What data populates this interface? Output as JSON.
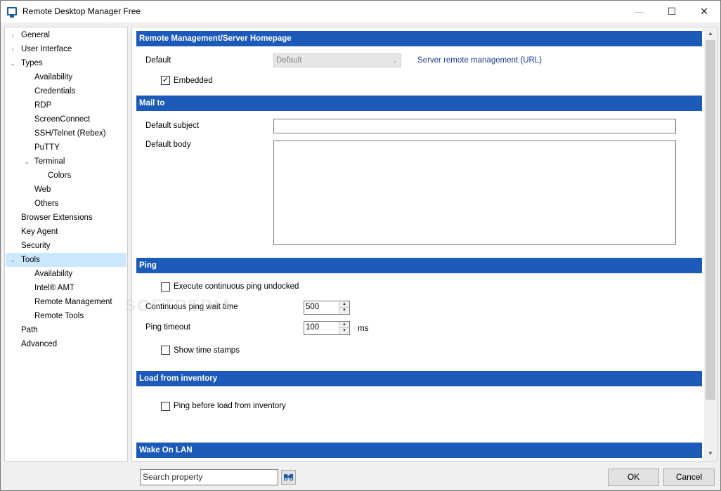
{
  "window": {
    "title": "Remote Desktop Manager Free"
  },
  "titlebar": {
    "minimize": "—",
    "maximize": "☐",
    "close": "✕"
  },
  "sidebar": {
    "items": [
      {
        "label": "General",
        "chev": "›"
      },
      {
        "label": "User Interface",
        "chev": "›"
      },
      {
        "label": "Types",
        "chev": "⌄"
      },
      {
        "label": "Availability"
      },
      {
        "label": "Credentials"
      },
      {
        "label": "RDP"
      },
      {
        "label": "ScreenConnect"
      },
      {
        "label": "SSH/Telnet (Rebex)"
      },
      {
        "label": "PuTTY"
      },
      {
        "label": "Terminal",
        "chev": "⌄"
      },
      {
        "label": "Colors"
      },
      {
        "label": "Web"
      },
      {
        "label": "Others"
      },
      {
        "label": "Browser Extensions"
      },
      {
        "label": "Key Agent"
      },
      {
        "label": "Security"
      },
      {
        "label": "Tools",
        "chev": "⌄"
      },
      {
        "label": "Availability"
      },
      {
        "label": "Intel® AMT"
      },
      {
        "label": "Remote Management"
      },
      {
        "label": "Remote Tools"
      },
      {
        "label": "Path"
      },
      {
        "label": "Advanced"
      }
    ]
  },
  "remote_management": {
    "header": "Remote Management/Server Homepage",
    "default_label": "Default",
    "default_value": "Default",
    "link": "Server remote management (URL)",
    "embedded_label": "Embedded",
    "embedded_checked": "✓"
  },
  "mail_to": {
    "header": "Mail to",
    "subject_label": "Default subject",
    "subject_value": "",
    "body_label": "Default body",
    "body_value": ""
  },
  "ping": {
    "header": "Ping",
    "undocked_label": "Execute continuous ping undocked",
    "wait_label": "Continuous ping wait time",
    "wait_value": "500",
    "timeout_label": "Ping timeout",
    "timeout_value": "100",
    "timeout_unit": "ms",
    "timestamps_label": "Show time stamps"
  },
  "inventory": {
    "header": "Load from inventory",
    "ping_before_label": "Ping before load from inventory"
  },
  "wake_on_lan": {
    "header": "Wake On LAN"
  },
  "footer": {
    "search_placeholder": "Search property",
    "ok": "OK",
    "cancel": "Cancel"
  },
  "watermark": "SOFTPEDIA",
  "colors": {
    "section_header": "#1c5ab9",
    "selected": "#cce8ff",
    "link": "#1c3c8c"
  }
}
